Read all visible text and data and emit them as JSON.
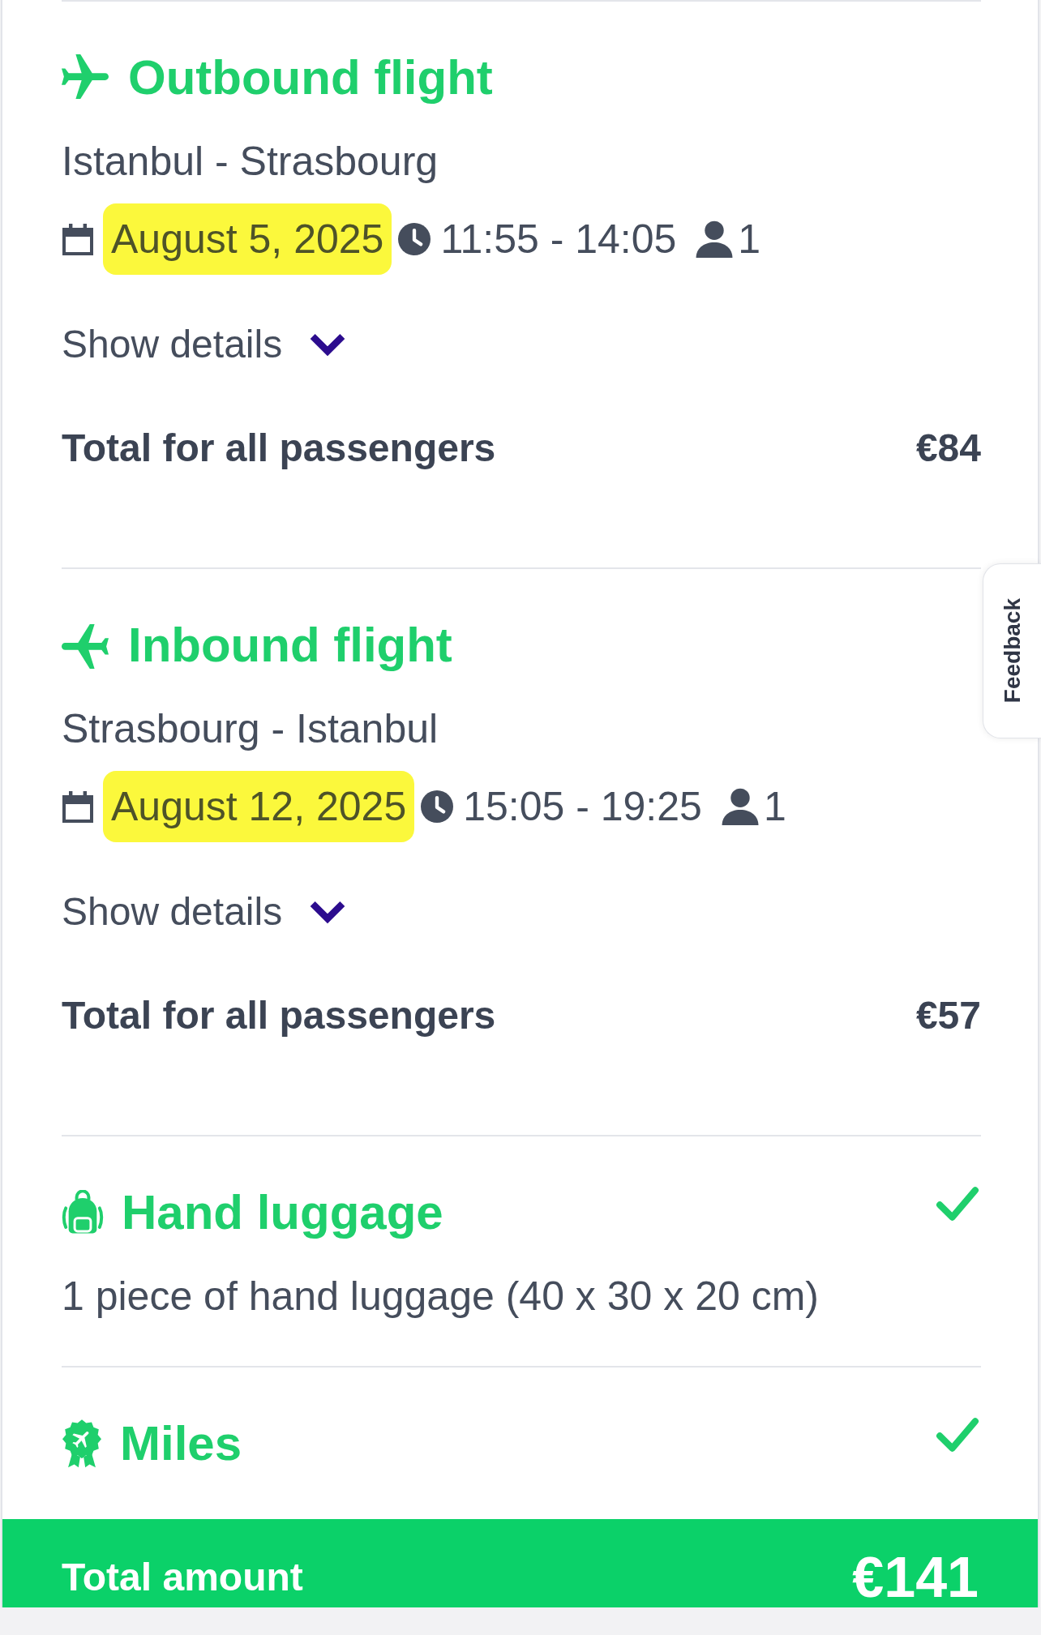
{
  "flights": [
    {
      "kind": "outbound",
      "title": "Outbound flight",
      "route": "Istanbul - Strasbourg",
      "date": "August 5, 2025",
      "date_highlighted": true,
      "time": "11:55 - 14:05",
      "passengers": "1",
      "details_link": "Show details",
      "expanded": false,
      "total_label": "Total for all passengers",
      "total_price": "€84"
    },
    {
      "kind": "inbound",
      "title": "Inbound flight",
      "route": "Strasbourg - Istanbul",
      "date": "August 12, 2025",
      "date_highlighted": true,
      "time": "15:05 - 19:25",
      "passengers": "1",
      "details_link": "Show details",
      "expanded": false,
      "total_label": "Total for all passengers",
      "total_price": "€57"
    }
  ],
  "extras": [
    {
      "kind": "luggage",
      "title": "Hand luggage",
      "description": "1 piece of hand luggage (40 x 30 x 20 cm)",
      "included": true
    },
    {
      "kind": "miles",
      "title": "Miles",
      "included": true
    }
  ],
  "total_bar": {
    "label": "Total amount",
    "price": "€141"
  },
  "feedback_tab": {
    "label": "Feedback"
  }
}
